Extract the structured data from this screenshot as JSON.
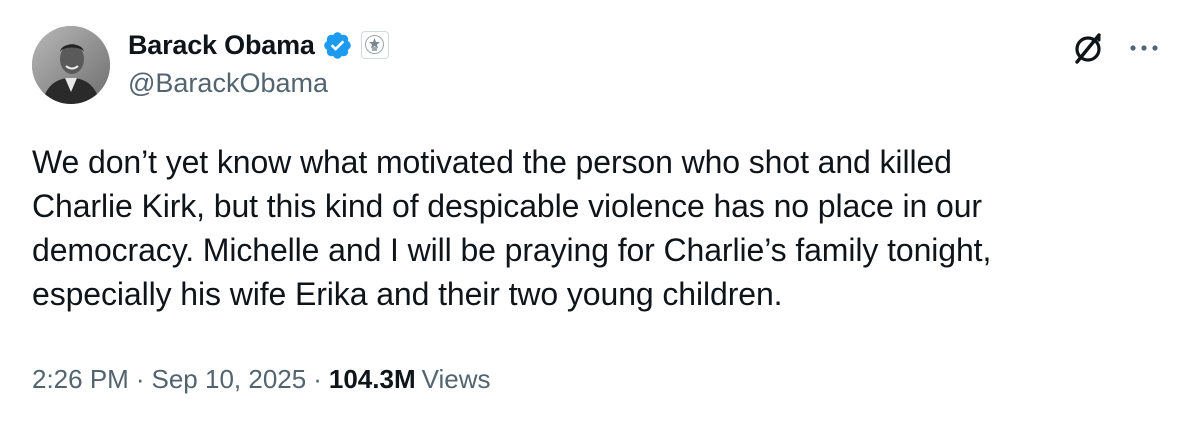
{
  "author": {
    "display_name": "Barack Obama",
    "handle": "@BarackObama"
  },
  "icons": {
    "verified": "verified-badge-icon",
    "affiliation": "government-seal-icon",
    "grok": "grok-icon",
    "more": "more-options-icon"
  },
  "tweet": {
    "lines": [
      "We don’t yet know what motivated the person who shot and killed",
      "Charlie Kirk, but this kind of despicable violence has no place in our",
      "democracy. Michelle and I will be praying for Charlie’s family tonight,",
      "especially his wife Erika and their two young children."
    ]
  },
  "meta": {
    "time": "2:26 PM",
    "separator": "·",
    "date": "Sep 10, 2025",
    "views_count": "104.3M",
    "views_label": "Views"
  },
  "colors": {
    "text": "#0f1419",
    "secondary": "#536471",
    "verified": "#1d9bf0"
  }
}
